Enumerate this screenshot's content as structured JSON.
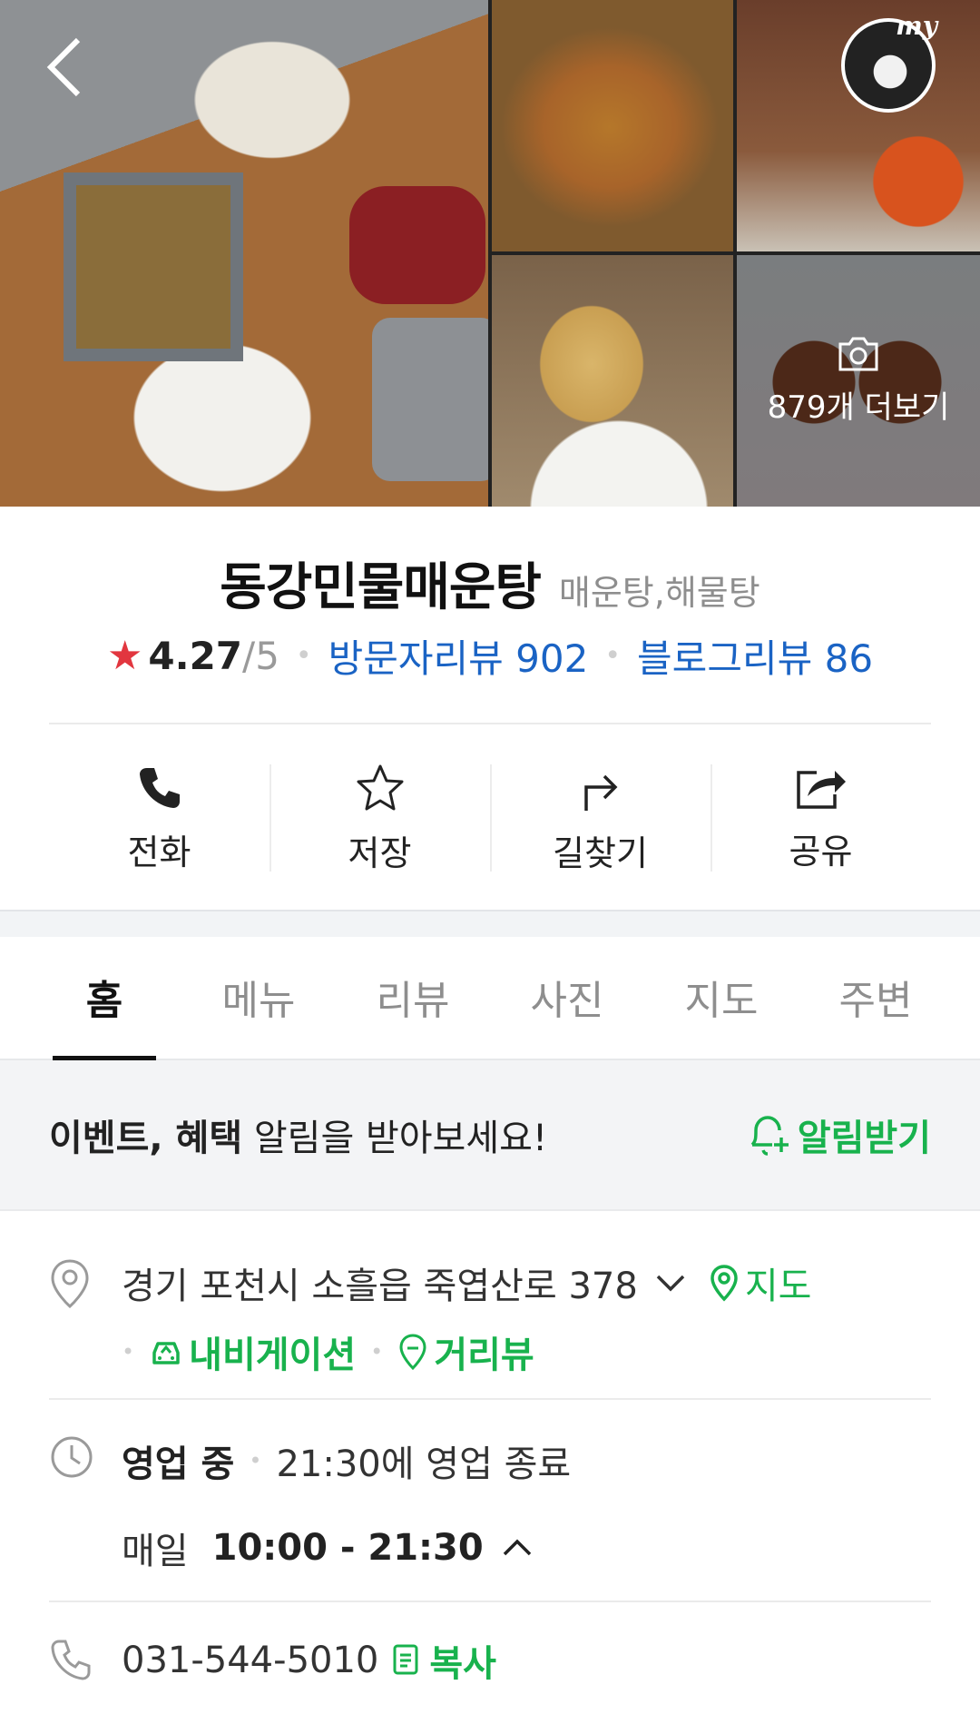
{
  "gallery": {
    "more_label": "879개 더보기",
    "avatar_badge": "my"
  },
  "place": {
    "name": "동강민물매운탕",
    "category": "매운탕,해물탕",
    "rating": "4.27",
    "rating_max": "/5",
    "visitor_reviews": "방문자리뷰 902",
    "blog_reviews": "블로그리뷰 86"
  },
  "actions": {
    "call": "전화",
    "save": "저장",
    "directions": "길찾기",
    "share": "공유"
  },
  "tabs": [
    "홈",
    "메뉴",
    "리뷰",
    "사진",
    "지도",
    "주변"
  ],
  "banner": {
    "bold_text": "이벤트, 혜택",
    "text": " 알림을 받아보세요!",
    "button": "알림받기"
  },
  "address": {
    "text": "경기 포천시 소흘읍 죽엽산로 378",
    "map_link": "지도",
    "navigation_link": "내비게이션",
    "streetview_link": "거리뷰"
  },
  "hours": {
    "status": "영업 중",
    "closing": "21:30에 영업 종료",
    "day": "매일",
    "time": "10:00 - 21:30"
  },
  "phone": {
    "number": "031-544-5010",
    "copy": "복사"
  },
  "colors": {
    "accent_green": "#18b24d",
    "link_blue": "#1a63c4",
    "star_red": "#e2363f"
  }
}
